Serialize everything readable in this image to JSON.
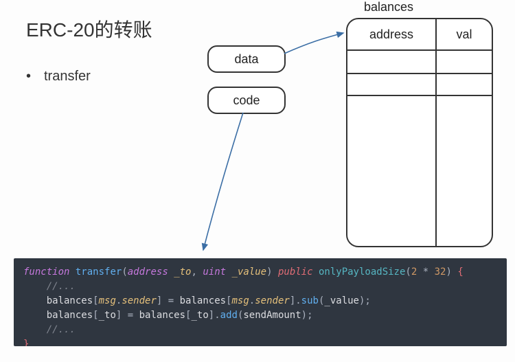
{
  "title": "ERC-20的转账",
  "bullet": "transfer",
  "diagram": {
    "data_box": "data",
    "code_box": "code",
    "balances_label": "balances",
    "table_headers": {
      "col1": "address",
      "col2": "val"
    }
  },
  "code": {
    "kw_function": "function",
    "fn_name": "transfer",
    "type_address": "address",
    "param_to": "_to",
    "type_uint": "uint",
    "param_value": "_value",
    "mod_public": "public",
    "attr_onlyPayloadSize": "onlyPayloadSize",
    "num_2": "2",
    "num_32": "32",
    "brace_open": "{",
    "brace_close": "}",
    "comment": "//...",
    "l2_balances": "balances",
    "l2_msg": "msg",
    "l2_sender": "sender",
    "l2_sub": "sub",
    "l2_value": "_value",
    "l3_balances": "balances",
    "l3_to": "_to",
    "l3_add": "add",
    "l3_sendAmount": "sendAmount"
  }
}
